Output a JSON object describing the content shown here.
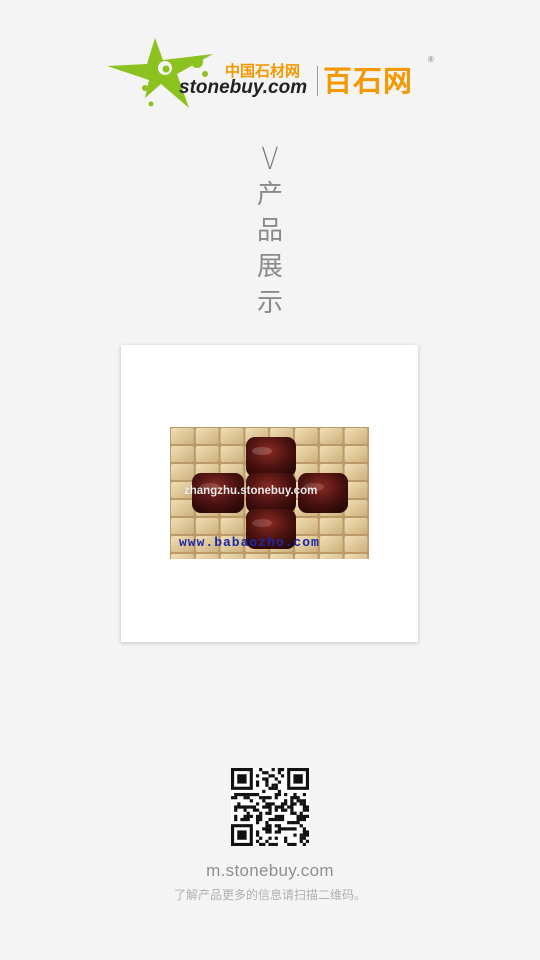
{
  "header": {
    "logo_cn_small": "中国石材网",
    "logo_domain": "stonebuy.com",
    "logo_cn_big": "百石网",
    "logo_reg": "®",
    "logo_icon": "green-star-splash-icon"
  },
  "section": {
    "title_letter": "V",
    "title_chars": [
      "产",
      "品",
      "展",
      "示"
    ]
  },
  "product": {
    "image_icon": "stone-mosaic-tile-photo",
    "watermark_1": "zhangzhu.stonebuy.com",
    "watermark_2": "www.babaozho.com"
  },
  "footer": {
    "qr_icon": "qr-code-icon",
    "url": "m.stonebuy.com",
    "hint": "了解产品更多的信息请扫描二维码。"
  },
  "colors": {
    "background": "#f4f4f4",
    "brand_orange": "#f39800",
    "brand_green": "#8cc21f",
    "text_gray": "#8f8f8f"
  }
}
